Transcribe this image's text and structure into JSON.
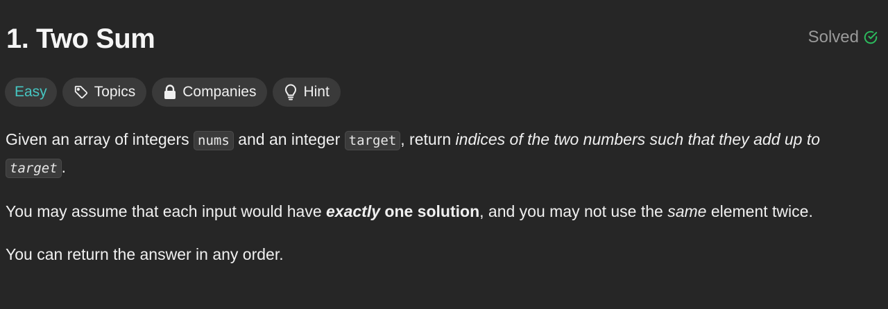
{
  "problem": {
    "title": "1. Two Sum",
    "status": "Solved"
  },
  "chips": {
    "difficulty": "Easy",
    "topics": "Topics",
    "companies": "Companies",
    "hint": "Hint"
  },
  "colors": {
    "easy": "#46c6c2",
    "solved_check": "#2cbb5d"
  },
  "description": {
    "p1": {
      "t1": "Given an array of integers ",
      "c1": "nums",
      "t2": " and an integer ",
      "c2": "target",
      "t3": ", return ",
      "em1": "indices of the two numbers such that they add up to ",
      "c3": "target",
      "t4": "."
    },
    "p2": {
      "t1": "You may assume that each input would have ",
      "em_strong": "exactly",
      "strong": " one solution",
      "t2": ", and you may not use the ",
      "em": "same",
      "t3": " element twice."
    },
    "p3": "You can return the answer in any order."
  }
}
